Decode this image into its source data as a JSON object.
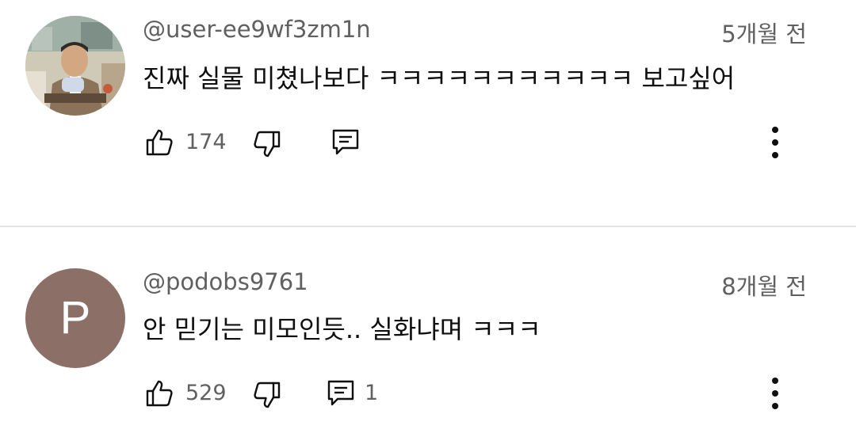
{
  "comments": [
    {
      "handle": "@user-ee9wf3zm1n",
      "time": "5개월 전",
      "text": "진짜 실물 미쳤나보다 ㅋㅋㅋㅋㅋㅋㅋㅋㅋㅋㅋ 보고싶어",
      "likes": "174",
      "replies": "",
      "avatar_type": "photo"
    },
    {
      "handle": "@podobs9761",
      "time": "8개월 전",
      "text": "안 믿기는 미모인듯.. 실화냐며 ㅋㅋㅋ",
      "likes": "529",
      "replies": "1",
      "avatar_type": "letter",
      "avatar_letter": "P",
      "avatar_color": "#8c6f66"
    }
  ],
  "icons": {
    "like": "thumbs-up-icon",
    "dislike": "thumbs-down-icon",
    "reply": "reply-icon",
    "more": "more-vertical-icon"
  }
}
